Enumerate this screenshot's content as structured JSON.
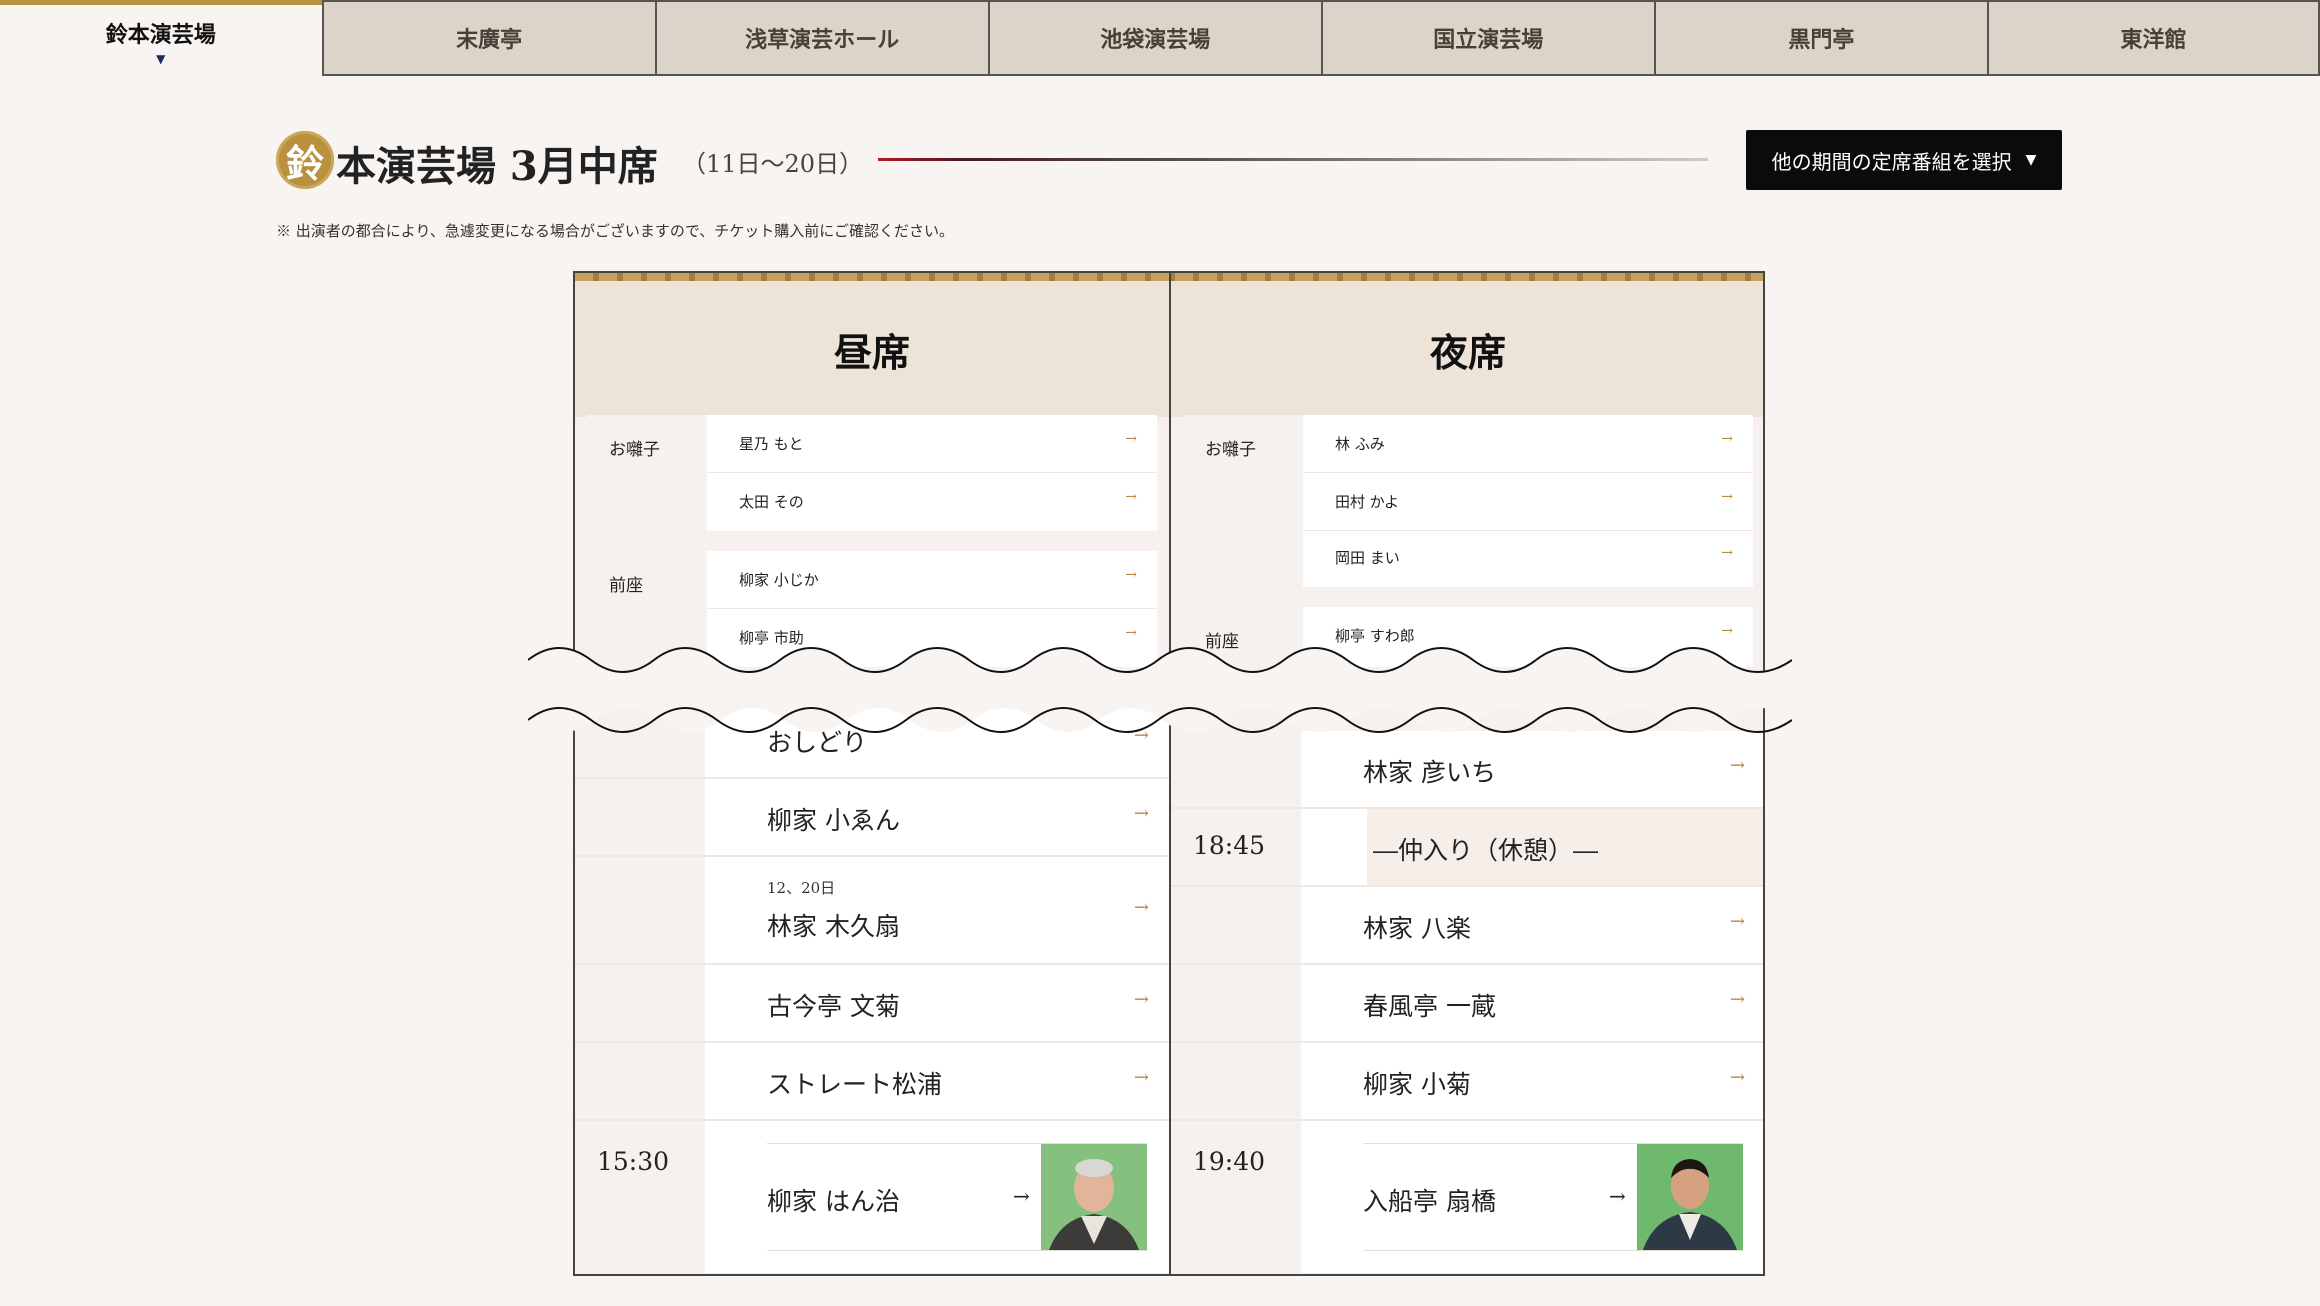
{
  "tabs": [
    {
      "label": "鈴本演芸場",
      "active": true
    },
    {
      "label": "末廣亭"
    },
    {
      "label": "浅草演芸ホール"
    },
    {
      "label": "池袋演芸場"
    },
    {
      "label": "国立演芸場"
    },
    {
      "label": "黒門亭"
    },
    {
      "label": "東洋館"
    }
  ],
  "header": {
    "badge": "鈴",
    "title": "本演芸場 3月中席",
    "period": "（11日〜20日）",
    "select_label": "他の期間の定席番組を選択",
    "select_arrow": "▼",
    "notice": "※ 出演者の都合により、急遽変更になる場合がございますので、チケット購入前にご確認ください。"
  },
  "day": {
    "heading": "昼席",
    "ohayashi_label": "お囃子",
    "ohayashi": [
      "星乃 もと",
      "太田 その"
    ],
    "zenza_label": "前座",
    "zenza": [
      "柳家 小じか",
      "柳亭 市助"
    ],
    "acts": [
      {
        "name": "おしどり"
      },
      {
        "name": "柳家 小ゑん"
      },
      {
        "date": "12、20日",
        "name": "林家 木久扇"
      },
      {
        "name": "古今亭 文菊"
      },
      {
        "name": "ストレート松浦"
      }
    ],
    "closing": {
      "time": "15:30",
      "name": "柳家 はん治"
    }
  },
  "night": {
    "heading": "夜席",
    "ohayashi_label": "お囃子",
    "ohayashi": [
      "林 ふみ",
      "田村 かよ",
      "岡田 まい"
    ],
    "zenza_label": "前座",
    "zenza": [
      "柳亭 すわ郎"
    ],
    "acts": [
      {
        "name": "林家 彦いち"
      },
      {
        "time": "18:45",
        "name": "―仲入り（休憩）―",
        "intermission": true
      },
      {
        "name": "林家 八楽"
      },
      {
        "name": "春風亭 一蔵"
      },
      {
        "name": "柳家 小菊"
      }
    ],
    "closing": {
      "time": "19:40",
      "name": "入船亭 扇橋"
    }
  },
  "arrow_glyph": "→",
  "colors": {
    "accent_gold": "#b8933f",
    "button_bg": "#0b0b0b",
    "rule_red": "#b41828"
  }
}
